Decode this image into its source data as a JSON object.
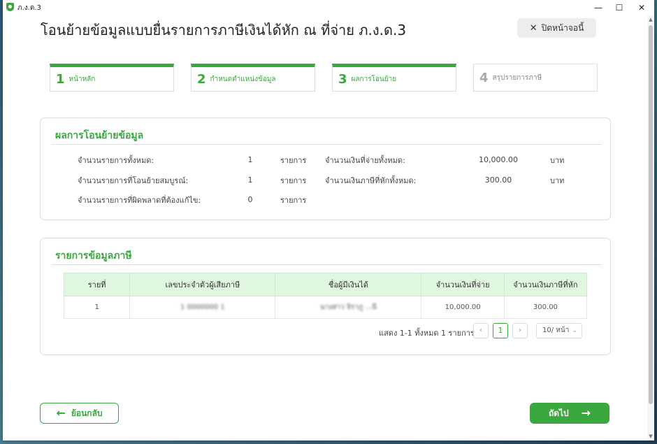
{
  "window": {
    "app_name": "ภ.ง.ด.3",
    "controls": {
      "minimize": "—",
      "maximize": "☐",
      "close": "✕"
    }
  },
  "page": {
    "title": "โอนย้ายข้อมูลแบบยื่นรายการภาษีเงินได้หัก ณ ที่จ่าย ภ.ง.ด.3",
    "close_button": "ปิดหน้าจอนี้"
  },
  "steps": [
    {
      "num": "1",
      "label": "หน้าหลัก",
      "active": true
    },
    {
      "num": "2",
      "label": "กำหนดตำแหน่งข้อมูล",
      "active": true
    },
    {
      "num": "3",
      "label": "ผลการโอนย้าย",
      "active": true
    },
    {
      "num": "4",
      "label": "สรุปรายการภาษี",
      "active": false
    }
  ],
  "summary": {
    "title": "ผลการโอนย้ายข้อมูล",
    "rows": [
      {
        "label": "จำนวนรายการทั้งหมด:",
        "value": "1",
        "unit": "รายการ"
      },
      {
        "label": "จำนวนรายการที่โอนย้ายสมบูรณ์:",
        "value": "1",
        "unit": "รายการ"
      },
      {
        "label": "จำนวนรายการที่ผิดพลาดที่ต้องแก้ไข:",
        "value": "0",
        "unit": "รายการ"
      }
    ],
    "amounts": [
      {
        "label": "จำนวนเงินที่จ่ายทั้งหมด:",
        "value": "10,000.00",
        "unit": "บาท"
      },
      {
        "label": "จำนวนเงินภาษีที่หักทั้งหมด:",
        "value": "300.00",
        "unit": "บาท"
      }
    ]
  },
  "tax_list": {
    "title": "รายการข้อมูลภาษี",
    "columns": [
      "รายที่",
      "เลขประจำตัวผู้เสียภาษี",
      "ชื่อผู้มีเงินได้",
      "จำนวนเงินที่จ่าย",
      "จำนวนเงินภาษีที่หัก"
    ],
    "rows": [
      {
        "no": "1",
        "tax_id": "1 0000000 1",
        "name": "นางสาว จิราภู ...นี",
        "paid": "10,000.00",
        "tax": "300.00"
      }
    ],
    "pager": {
      "info": "แสดง 1-1 ทั้งหมด 1 รายการ",
      "prev": "‹",
      "current": "1",
      "next": "›",
      "page_size": "10/ หน้า",
      "chevron": "⌄"
    }
  },
  "footer": {
    "back_label": "ย้อนกลับ",
    "back_arrow": "←",
    "next_label": "ถัดไป",
    "next_arrow": "→"
  },
  "colors": {
    "accent": "#3aa73f",
    "header_bg": "#dff6df"
  }
}
